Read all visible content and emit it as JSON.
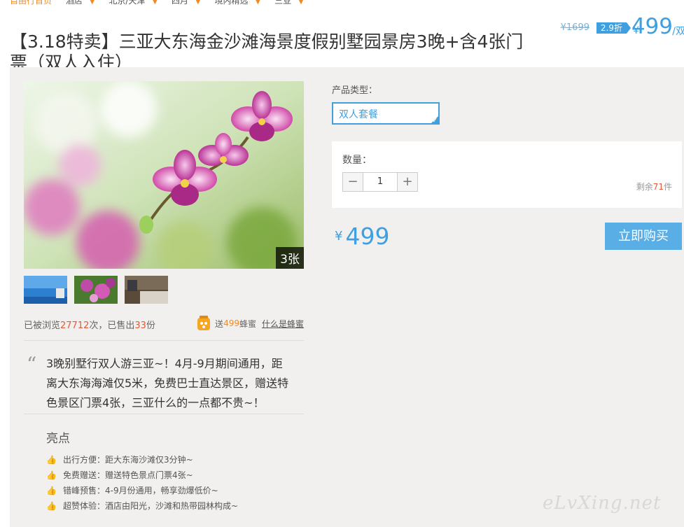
{
  "breadcrumb": [
    {
      "label": "自由行首页"
    },
    {
      "label": "酒店"
    },
    {
      "label": "北京/天津"
    },
    {
      "label": "四月"
    },
    {
      "label": "境内精选"
    },
    {
      "label": "三亚"
    }
  ],
  "title": "【3.18特卖】三亚大东海金沙滩海景度假别墅园景房3晚+含4张门票（双人入住）",
  "price_header": {
    "original": "¥1699",
    "discount": "2.9折",
    "currency": "¥",
    "price": "499",
    "unit": "/双"
  },
  "gallery": {
    "image_count": "3张",
    "thumbnails": [
      "sky-beach-thumb",
      "orchid-thumb",
      "room-thumb"
    ]
  },
  "stats": {
    "views_prefix": "已被浏览",
    "views": "27712",
    "views_suffix": "次，已售出",
    "sold": "33",
    "sold_suffix": "份",
    "gift_prefix": "送",
    "gift_amount": "499",
    "gift_suffix": "蜂蜜",
    "gift_link": "什么是蜂蜜"
  },
  "intro": "3晚别墅行双人游三亚~！4月-9月期间通用，距离大东海海滩仅5米，免费巴士直达景区，赠送特色景区门票4张，三亚什么的一点都不贵~！",
  "highlights": {
    "title": "亮点",
    "items": [
      "出行方便：距大东海沙滩仅3分钟~",
      "免费赠送：赠送特色景点门票4张~",
      "错峰预售：4-9月份通用，畅享劲爆低价~",
      "超赞体验：酒店由阳光，沙滩和热带园林构成~"
    ]
  },
  "product": {
    "type_label": "产品类型：",
    "type_option": "双人套餐",
    "qty_label": "数量：",
    "minus": "−",
    "qty": "1",
    "plus": "+",
    "stock_prefix": "剩余",
    "stock": "71",
    "stock_suffix": "件",
    "currency": "¥",
    "price": "499",
    "buy": "立即购买"
  },
  "watermark": "eLvXing.net",
  "colors": {
    "accent": "#3f9fdf",
    "orange": "#f08a24",
    "red": "#e05a3a",
    "panel": "#f1f0ee"
  }
}
